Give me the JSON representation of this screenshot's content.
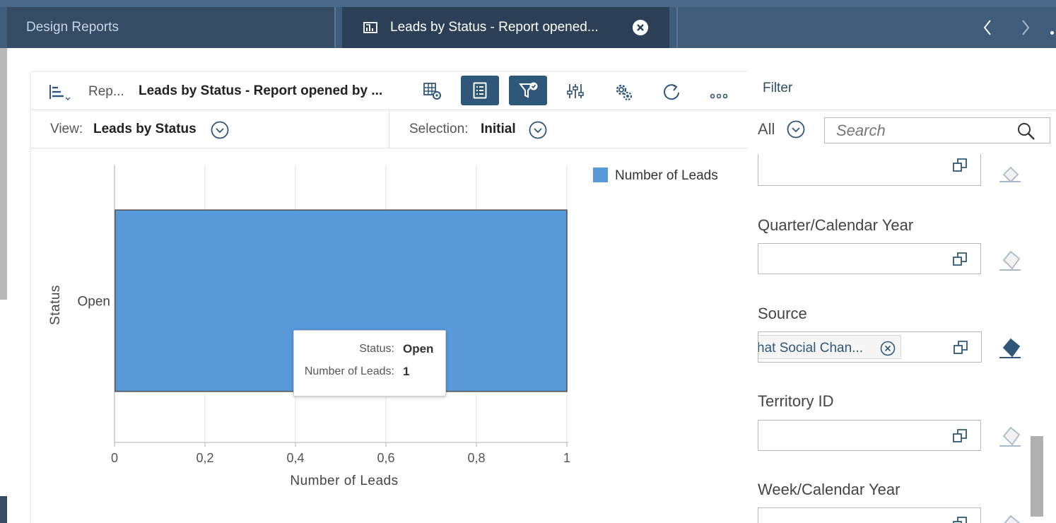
{
  "tabs": {
    "design_reports": "Design Reports",
    "active_tab_title": "Leads by Status - Report opened..."
  },
  "toolbar": {
    "crumb": "Rep...",
    "report_title": "Leads by Status - Report opened by ..."
  },
  "view": {
    "view_label": "View:",
    "view_value": "Leads by Status",
    "selection_label": "Selection:",
    "selection_value": "Initial"
  },
  "chart_data": {
    "type": "bar",
    "orientation": "horizontal",
    "categories": [
      "Open"
    ],
    "series": [
      {
        "name": "Number of Leads",
        "values": [
          1
        ],
        "color": "#5899da"
      }
    ],
    "xlabel": "Number of Leads",
    "ylabel": "Status",
    "xlim": [
      0,
      1
    ],
    "x_ticks": [
      0,
      0.2,
      0.4,
      0.6,
      0.8,
      1
    ],
    "x_tick_labels": [
      "0",
      "0,2",
      "0,4",
      "0,6",
      "0,8",
      "1"
    ],
    "grid": true,
    "legend_position": "top-right"
  },
  "tooltip": {
    "status_label": "Status:",
    "status_value": "Open",
    "leads_label": "Number of Leads:",
    "leads_value": "1"
  },
  "filter": {
    "title": "Filter",
    "all_label": "All",
    "search_placeholder": "Search",
    "fields": [
      {
        "label": "",
        "value": ""
      },
      {
        "label": "Quarter/Calendar Year",
        "value": ""
      },
      {
        "label": "Source",
        "value": "hat Social Chan..."
      },
      {
        "label": "Territory ID",
        "value": ""
      },
      {
        "label": "Week/Calendar Year",
        "value": ""
      }
    ]
  },
  "colors": {
    "shell_bar": "#3f5c7a",
    "active_tab": "#2b4057",
    "accent_button": "#2f5779",
    "bar_fill": "#5899da"
  }
}
